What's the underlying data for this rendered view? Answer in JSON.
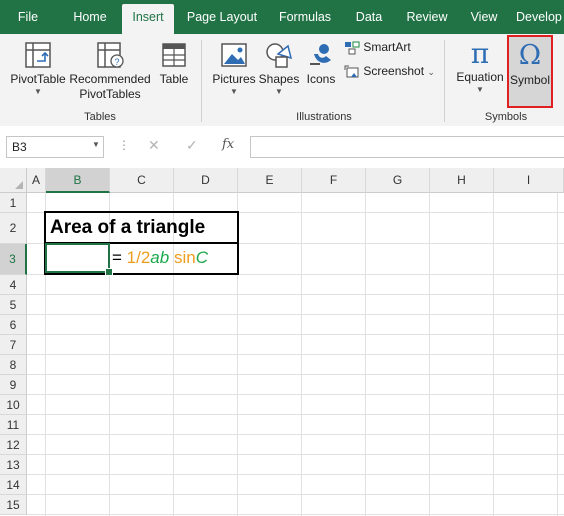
{
  "tabs": [
    "File",
    "Home",
    "Insert",
    "Page Layout",
    "Formulas",
    "Data",
    "Review",
    "View",
    "Develop"
  ],
  "active_tab": "Insert",
  "ribbon": {
    "tables": {
      "pivot": "PivotTable",
      "recommended_line1": "Recommended",
      "recommended_line2": "PivotTables",
      "table": "Table",
      "group": "Tables"
    },
    "illustrations": {
      "pictures": "Pictures",
      "shapes": "Shapes",
      "icons": "Icons",
      "smartart": "SmartArt",
      "screenshot": "Screenshot",
      "group": "Illustrations"
    },
    "symbols": {
      "equation": "Equation",
      "symbol": "Symbol",
      "group": "Symbols"
    }
  },
  "formula_bar": {
    "name_box": "B3",
    "fx": "fx",
    "cancel": "✕",
    "enter": "✓",
    "content": ""
  },
  "columns": [
    "A",
    "B",
    "C",
    "D",
    "E",
    "F",
    "G",
    "H",
    "I"
  ],
  "rows": [
    "1",
    "2",
    "3",
    "4",
    "5",
    "6",
    "7",
    "8",
    "9",
    "10",
    "11",
    "12",
    "13",
    "14",
    "15"
  ],
  "selected_cell": "B3",
  "cells": {
    "title": "Area of a triangle",
    "formula": {
      "eq": "= ",
      "half": "1/2",
      "ab": "ab",
      "sin": " sin",
      "C": "C"
    }
  },
  "colors": {
    "excel_green": "#217346",
    "orange": "#ED9E1B",
    "green": "#1BA84A",
    "highlight_red": "#E02020"
  }
}
